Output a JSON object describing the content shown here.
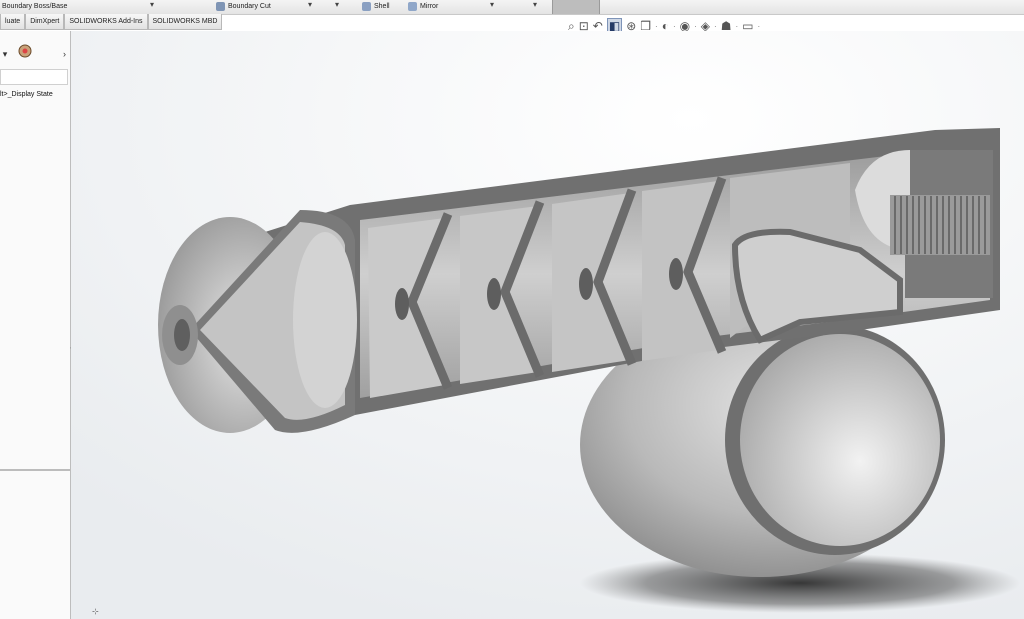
{
  "ribbon": {
    "boundary_boss": "Boundary Boss/Base",
    "boundary_cut": "Boundary Cut",
    "shell": "Shell",
    "mirror": "Mirror",
    "dropdown_glyph": "▾"
  },
  "tabs": [
    "luate",
    "DimXpert",
    "SOLIDWORKS Add-Ins",
    "SOLIDWORKS MBD"
  ],
  "feature_manager": {
    "tab_chevron": "›",
    "tree_item": "lt>_Display State"
  },
  "view_toolbar": {
    "icons": [
      "zoom-to-fit-icon",
      "zoom-to-area-icon",
      "previous-view-icon",
      "section-view-icon",
      "dynamic-annotation-icon",
      "view-orientation-icon",
      "display-style-icon",
      "hide-show-icon",
      "edit-appearance-icon",
      "apply-scene-icon",
      "view-settings-icon"
    ]
  },
  "colors": {
    "ribbon": "#e8e8e8",
    "panel": "#fafafa",
    "section_face": "#6f6f6f",
    "metal_light": "#d4d4d4",
    "metal_dark": "#8e8e8e"
  }
}
